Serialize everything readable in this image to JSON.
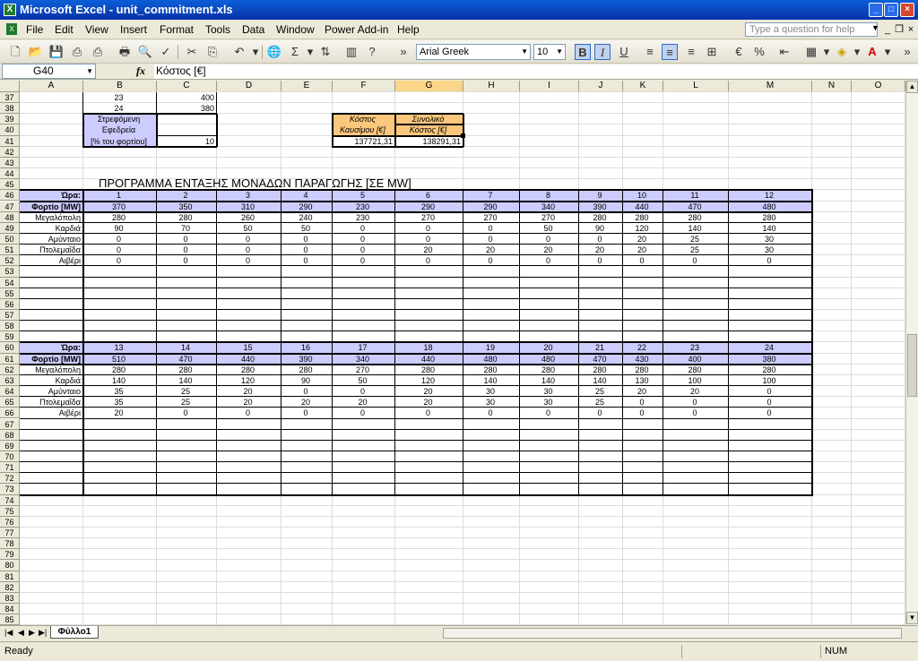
{
  "window": {
    "title": "Microsoft Excel - unit_commitment.xls",
    "min": "_",
    "max": "□",
    "close": "×"
  },
  "menu": [
    "File",
    "Edit",
    "View",
    "Insert",
    "Format",
    "Tools",
    "Data",
    "Window",
    "Power Add-in",
    "Help"
  ],
  "help_placeholder": "Type a question for help",
  "toolbar": {
    "font": "Arial Greek",
    "size": "10",
    "bold": "B",
    "italic": "I",
    "underline": "U",
    "percent": "%",
    "sigma": "Σ"
  },
  "namebox": "G40",
  "fx": "fx",
  "formula": "Κόστος [€]",
  "columns": [
    "A",
    "B",
    "C",
    "D",
    "E",
    "F",
    "G",
    "H",
    "I",
    "J",
    "K",
    "L",
    "M",
    "N",
    "O"
  ],
  "selected_column": "G",
  "first_row": 37,
  "last_row": 85,
  "top": {
    "r37": {
      "B": "23",
      "C": "400"
    },
    "r38": {
      "B": "24",
      "C": "380"
    },
    "reserve_label": [
      "Στρεφόμενη",
      "Εφεδρεία",
      "[% του φορτίου]"
    ],
    "reserve_value": "10",
    "fuel_cost_label": [
      "Κόστος",
      "Καυσίμου [€]"
    ],
    "fuel_cost_value": "137721,31",
    "total_cost_label": [
      "Συνολικό",
      "Κόστος [€]"
    ],
    "total_cost_value": "138291,31"
  },
  "heading": "ΠΡΟΓΡΑΜΜΑ ΕΝΤΑΞΗΣ ΜΟΝΑΔΩΝ ΠΑΡΑΓΩΓΗΣ  [ΣΕ MW]",
  "table1": {
    "hour_label": "Ώρα:",
    "load_label": "Φορτίο [MW]",
    "hours": [
      "1",
      "2",
      "3",
      "4",
      "5",
      "6",
      "7",
      "8",
      "9",
      "10",
      "11",
      "12"
    ],
    "load": [
      "370",
      "350",
      "310",
      "290",
      "230",
      "290",
      "290",
      "340",
      "390",
      "440",
      "470",
      "480"
    ],
    "units": [
      {
        "name": "Μεγαλόπολη",
        "values": [
          "280",
          "280",
          "260",
          "240",
          "230",
          "270",
          "270",
          "270",
          "280",
          "280",
          "280",
          "280"
        ]
      },
      {
        "name": "Καρδιά",
        "values": [
          "90",
          "70",
          "50",
          "50",
          "0",
          "0",
          "0",
          "50",
          "90",
          "120",
          "140",
          "140"
        ]
      },
      {
        "name": "Αμύνταιο",
        "values": [
          "0",
          "0",
          "0",
          "0",
          "0",
          "0",
          "0",
          "0",
          "0",
          "20",
          "25",
          "30"
        ]
      },
      {
        "name": "Πτολεμαΐδα",
        "values": [
          "0",
          "0",
          "0",
          "0",
          "0",
          "20",
          "20",
          "20",
          "20",
          "20",
          "25",
          "30"
        ]
      },
      {
        "name": "Αιβέρι",
        "values": [
          "0",
          "0",
          "0",
          "0",
          "0",
          "0",
          "0",
          "0",
          "0",
          "0",
          "0",
          "0"
        ]
      }
    ]
  },
  "table2": {
    "hour_label": "Ώρα:",
    "load_label": "Φορτίο [MW]",
    "hours": [
      "13",
      "14",
      "15",
      "16",
      "17",
      "18",
      "19",
      "20",
      "21",
      "22",
      "23",
      "24"
    ],
    "load": [
      "510",
      "470",
      "440",
      "390",
      "340",
      "440",
      "480",
      "480",
      "470",
      "430",
      "400",
      "380"
    ],
    "units": [
      {
        "name": "Μεγαλόπολη",
        "values": [
          "280",
          "280",
          "280",
          "280",
          "270",
          "280",
          "280",
          "280",
          "280",
          "280",
          "280",
          "280"
        ]
      },
      {
        "name": "Καρδιά",
        "values": [
          "140",
          "140",
          "120",
          "90",
          "50",
          "120",
          "140",
          "140",
          "140",
          "130",
          "100",
          "100"
        ]
      },
      {
        "name": "Αμύνταιο",
        "values": [
          "35",
          "25",
          "20",
          "0",
          "0",
          "20",
          "30",
          "30",
          "25",
          "20",
          "20",
          "0"
        ]
      },
      {
        "name": "Πτολεμαΐδα",
        "values": [
          "35",
          "25",
          "20",
          "20",
          "20",
          "20",
          "30",
          "30",
          "25",
          "0",
          "0",
          "0"
        ]
      },
      {
        "name": "Αιβέρι",
        "values": [
          "20",
          "0",
          "0",
          "0",
          "0",
          "0",
          "0",
          "0",
          "0",
          "0",
          "0",
          "0"
        ]
      }
    ]
  },
  "sheet_tab": "Φύλλο1",
  "status": "Ready",
  "num": "NUM",
  "colors": {
    "title_bar": "#0831a8",
    "band": "#ccccff",
    "orange_cell": "#fbc77d",
    "selected_header": "#fbd68a"
  }
}
